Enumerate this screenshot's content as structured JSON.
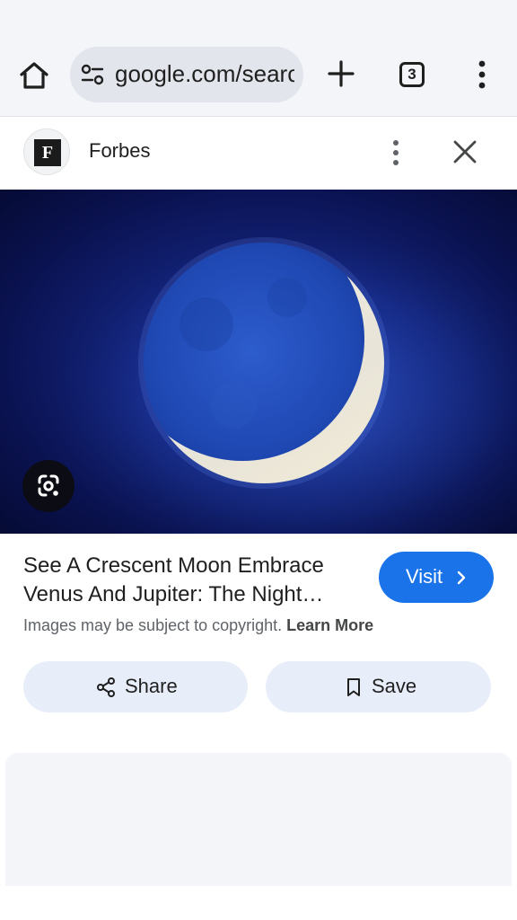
{
  "browser": {
    "url_text": "google.com/search",
    "tab_count": "3",
    "icons": {
      "home": "home-icon",
      "site_settings": "tune-icon",
      "new_tab": "plus-icon",
      "menu": "more-vert-icon"
    }
  },
  "source": {
    "logo_letter": "F",
    "name": "Forbes",
    "icons": {
      "more": "more-vert-icon",
      "close": "close-icon"
    }
  },
  "image": {
    "lens_icon": "google-lens-icon"
  },
  "result": {
    "title_line1": "See A Crescent Moon Embrace",
    "title_line2": "Venus And Jupiter: The Night…",
    "visit_label": "Visit",
    "copyright_text": "Images may be subject to copyright.",
    "learn_more": "Learn More"
  },
  "actions": {
    "share_label": "Share",
    "save_label": "Save",
    "share_icon": "share-icon",
    "save_icon": "bookmark-icon"
  },
  "colors": {
    "accent": "#1a73e8",
    "chrome_bg": "#f3f5f9",
    "pill_bg": "#e8eef9"
  }
}
